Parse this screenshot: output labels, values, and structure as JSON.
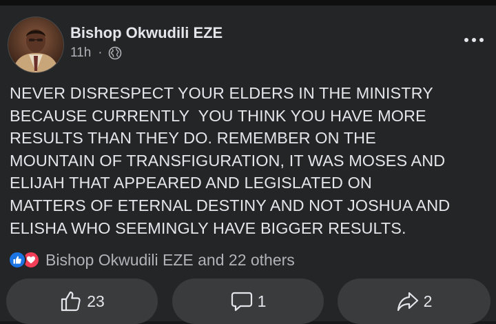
{
  "post": {
    "author": "Bishop Okwudili EZE",
    "time": "11h",
    "separator": "·",
    "privacy_icon": "globe-icon",
    "more_icon": "more-options-icon",
    "text_lines": [
      "NEVER DISRESPECT YOUR ELDERS IN THE MINISTRY",
      "BECAUSE CURRENTLY  YOU THINK YOU HAVE MORE",
      "RESULTS THAN THEY DO. REMEMBER ON THE",
      "MOUNTAIN OF TRANSFIGURATION, IT WAS MOSES AND",
      "ELIJAH THAT APPEARED AND LEGISLATED ON",
      "MATTERS OF ETERNAL DESTINY AND NOT JOSHUA AND",
      "ELISHA WHO SEEMINGLY HAVE BIGGER RESULTS."
    ]
  },
  "reactions": {
    "icons": [
      "like-reaction-icon",
      "love-reaction-icon"
    ],
    "summary": "Bishop Okwudili EZE and 22 others"
  },
  "actions": {
    "like_count": "23",
    "comment_count": "1",
    "share_count": "2"
  },
  "colors": {
    "background": "#18191a",
    "card": "#242526",
    "button": "#3a3b3c",
    "text_primary": "#e4e6eb",
    "text_secondary": "#b0b3b8",
    "like_blue": "#1b74e4",
    "love_red": "#f33e58"
  }
}
